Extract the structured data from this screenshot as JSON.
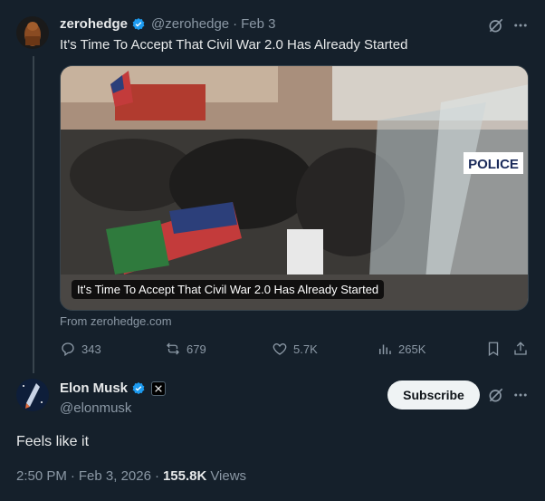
{
  "tweet1": {
    "author_name": "zerohedge",
    "handle": "@zerohedge",
    "separator": "·",
    "date": "Feb 3",
    "text": "It's Time To Accept That Civil War 2.0 Has Already Started",
    "media": {
      "caption": "It's Time To Accept That Civil War 2.0 Has Already Started",
      "source": "From zerohedge.com",
      "sign_text": "POLICE"
    },
    "actions": {
      "replies": "343",
      "reposts": "679",
      "likes": "5.7K",
      "views": "265K"
    }
  },
  "tweet2": {
    "author_name": "Elon Musk",
    "handle": "@elonmusk",
    "subscribe_label": "Subscribe",
    "text": "Feels like it",
    "time": "2:50 PM",
    "separator": "·",
    "date": "Feb 3, 2026",
    "views_count": "155.8K",
    "views_label": "Views"
  },
  "colors": {
    "background": "#15202b",
    "text": "#e7e9ea",
    "muted": "#8b98a5",
    "verified": "#1d9bf0",
    "divider": "#38444d"
  },
  "icons": [
    "grok-icon",
    "more-icon",
    "verified-icon",
    "reply-icon",
    "repost-icon",
    "like-icon",
    "views-icon",
    "bookmark-icon",
    "share-icon",
    "x-logo-icon"
  ]
}
